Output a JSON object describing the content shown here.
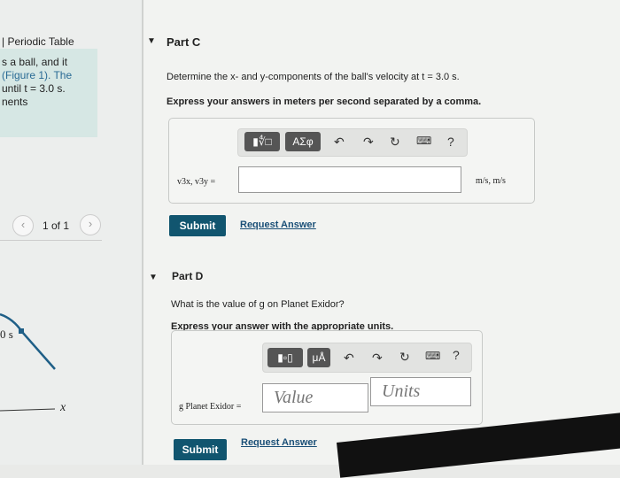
{
  "sidebar": {
    "periodic_table": "Periodic Table",
    "intro_lines": [
      "s a ball, and it",
      "(Figure 1). The",
      "until t = 3.0 s.",
      "nents"
    ],
    "pager": "1 of 1",
    "figure_label": "0 s",
    "axis_x": "x"
  },
  "part_c": {
    "title": "Part C",
    "question": "Determine the x- and y-components of the ball's velocity at t = 3.0 s.",
    "instruction": "Express your answers in meters per second separated by a comma.",
    "toolbar": {
      "templates": "▮∜□",
      "greek": "ΑΣφ",
      "help": "?"
    },
    "label": "v3x, v3y =",
    "input_value": "",
    "units": "m/s, m/s",
    "submit": "Submit",
    "request": "Request Answer"
  },
  "part_d": {
    "title": "Part D",
    "question": "What is the value of g on Planet Exidor?",
    "instruction": "Express your answer with the appropriate units.",
    "toolbar": {
      "templates": "▮▫▯",
      "units": "μÅ",
      "help": "?"
    },
    "label": "g Planet Exidor =",
    "value_placeholder": "Value",
    "units_placeholder": "Units",
    "submit": "Submit",
    "request": "Request Answer"
  }
}
